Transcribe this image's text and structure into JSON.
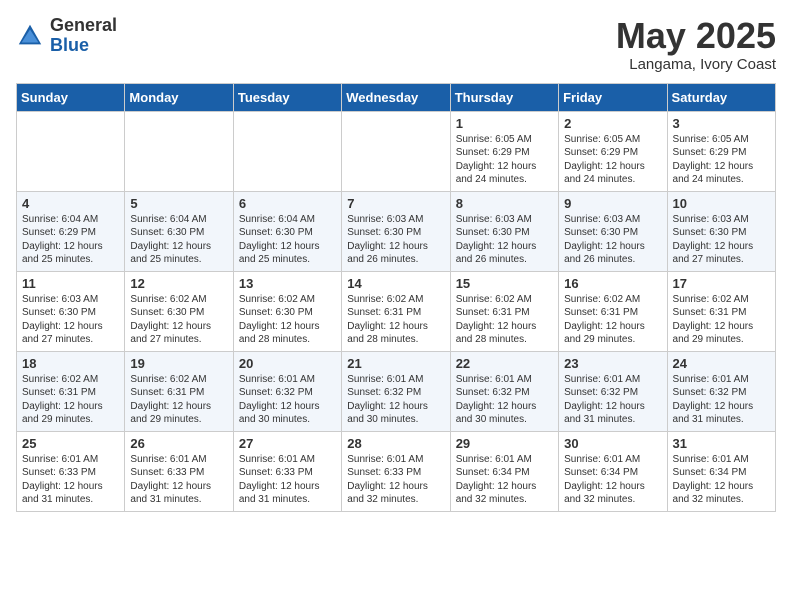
{
  "header": {
    "logo_general": "General",
    "logo_blue": "Blue",
    "month": "May 2025",
    "location": "Langama, Ivory Coast"
  },
  "days_of_week": [
    "Sunday",
    "Monday",
    "Tuesday",
    "Wednesday",
    "Thursday",
    "Friday",
    "Saturday"
  ],
  "weeks": [
    [
      {
        "day": "",
        "info": ""
      },
      {
        "day": "",
        "info": ""
      },
      {
        "day": "",
        "info": ""
      },
      {
        "day": "",
        "info": ""
      },
      {
        "day": "1",
        "info": "Sunrise: 6:05 AM\nSunset: 6:29 PM\nDaylight: 12 hours and 24 minutes."
      },
      {
        "day": "2",
        "info": "Sunrise: 6:05 AM\nSunset: 6:29 PM\nDaylight: 12 hours and 24 minutes."
      },
      {
        "day": "3",
        "info": "Sunrise: 6:05 AM\nSunset: 6:29 PM\nDaylight: 12 hours and 24 minutes."
      }
    ],
    [
      {
        "day": "4",
        "info": "Sunrise: 6:04 AM\nSunset: 6:29 PM\nDaylight: 12 hours and 25 minutes."
      },
      {
        "day": "5",
        "info": "Sunrise: 6:04 AM\nSunset: 6:30 PM\nDaylight: 12 hours and 25 minutes."
      },
      {
        "day": "6",
        "info": "Sunrise: 6:04 AM\nSunset: 6:30 PM\nDaylight: 12 hours and 25 minutes."
      },
      {
        "day": "7",
        "info": "Sunrise: 6:03 AM\nSunset: 6:30 PM\nDaylight: 12 hours and 26 minutes."
      },
      {
        "day": "8",
        "info": "Sunrise: 6:03 AM\nSunset: 6:30 PM\nDaylight: 12 hours and 26 minutes."
      },
      {
        "day": "9",
        "info": "Sunrise: 6:03 AM\nSunset: 6:30 PM\nDaylight: 12 hours and 26 minutes."
      },
      {
        "day": "10",
        "info": "Sunrise: 6:03 AM\nSunset: 6:30 PM\nDaylight: 12 hours and 27 minutes."
      }
    ],
    [
      {
        "day": "11",
        "info": "Sunrise: 6:03 AM\nSunset: 6:30 PM\nDaylight: 12 hours and 27 minutes."
      },
      {
        "day": "12",
        "info": "Sunrise: 6:02 AM\nSunset: 6:30 PM\nDaylight: 12 hours and 27 minutes."
      },
      {
        "day": "13",
        "info": "Sunrise: 6:02 AM\nSunset: 6:30 PM\nDaylight: 12 hours and 28 minutes."
      },
      {
        "day": "14",
        "info": "Sunrise: 6:02 AM\nSunset: 6:31 PM\nDaylight: 12 hours and 28 minutes."
      },
      {
        "day": "15",
        "info": "Sunrise: 6:02 AM\nSunset: 6:31 PM\nDaylight: 12 hours and 28 minutes."
      },
      {
        "day": "16",
        "info": "Sunrise: 6:02 AM\nSunset: 6:31 PM\nDaylight: 12 hours and 29 minutes."
      },
      {
        "day": "17",
        "info": "Sunrise: 6:02 AM\nSunset: 6:31 PM\nDaylight: 12 hours and 29 minutes."
      }
    ],
    [
      {
        "day": "18",
        "info": "Sunrise: 6:02 AM\nSunset: 6:31 PM\nDaylight: 12 hours and 29 minutes."
      },
      {
        "day": "19",
        "info": "Sunrise: 6:02 AM\nSunset: 6:31 PM\nDaylight: 12 hours and 29 minutes."
      },
      {
        "day": "20",
        "info": "Sunrise: 6:01 AM\nSunset: 6:32 PM\nDaylight: 12 hours and 30 minutes."
      },
      {
        "day": "21",
        "info": "Sunrise: 6:01 AM\nSunset: 6:32 PM\nDaylight: 12 hours and 30 minutes."
      },
      {
        "day": "22",
        "info": "Sunrise: 6:01 AM\nSunset: 6:32 PM\nDaylight: 12 hours and 30 minutes."
      },
      {
        "day": "23",
        "info": "Sunrise: 6:01 AM\nSunset: 6:32 PM\nDaylight: 12 hours and 31 minutes."
      },
      {
        "day": "24",
        "info": "Sunrise: 6:01 AM\nSunset: 6:32 PM\nDaylight: 12 hours and 31 minutes."
      }
    ],
    [
      {
        "day": "25",
        "info": "Sunrise: 6:01 AM\nSunset: 6:33 PM\nDaylight: 12 hours and 31 minutes."
      },
      {
        "day": "26",
        "info": "Sunrise: 6:01 AM\nSunset: 6:33 PM\nDaylight: 12 hours and 31 minutes."
      },
      {
        "day": "27",
        "info": "Sunrise: 6:01 AM\nSunset: 6:33 PM\nDaylight: 12 hours and 31 minutes."
      },
      {
        "day": "28",
        "info": "Sunrise: 6:01 AM\nSunset: 6:33 PM\nDaylight: 12 hours and 32 minutes."
      },
      {
        "day": "29",
        "info": "Sunrise: 6:01 AM\nSunset: 6:34 PM\nDaylight: 12 hours and 32 minutes."
      },
      {
        "day": "30",
        "info": "Sunrise: 6:01 AM\nSunset: 6:34 PM\nDaylight: 12 hours and 32 minutes."
      },
      {
        "day": "31",
        "info": "Sunrise: 6:01 AM\nSunset: 6:34 PM\nDaylight: 12 hours and 32 minutes."
      }
    ]
  ]
}
